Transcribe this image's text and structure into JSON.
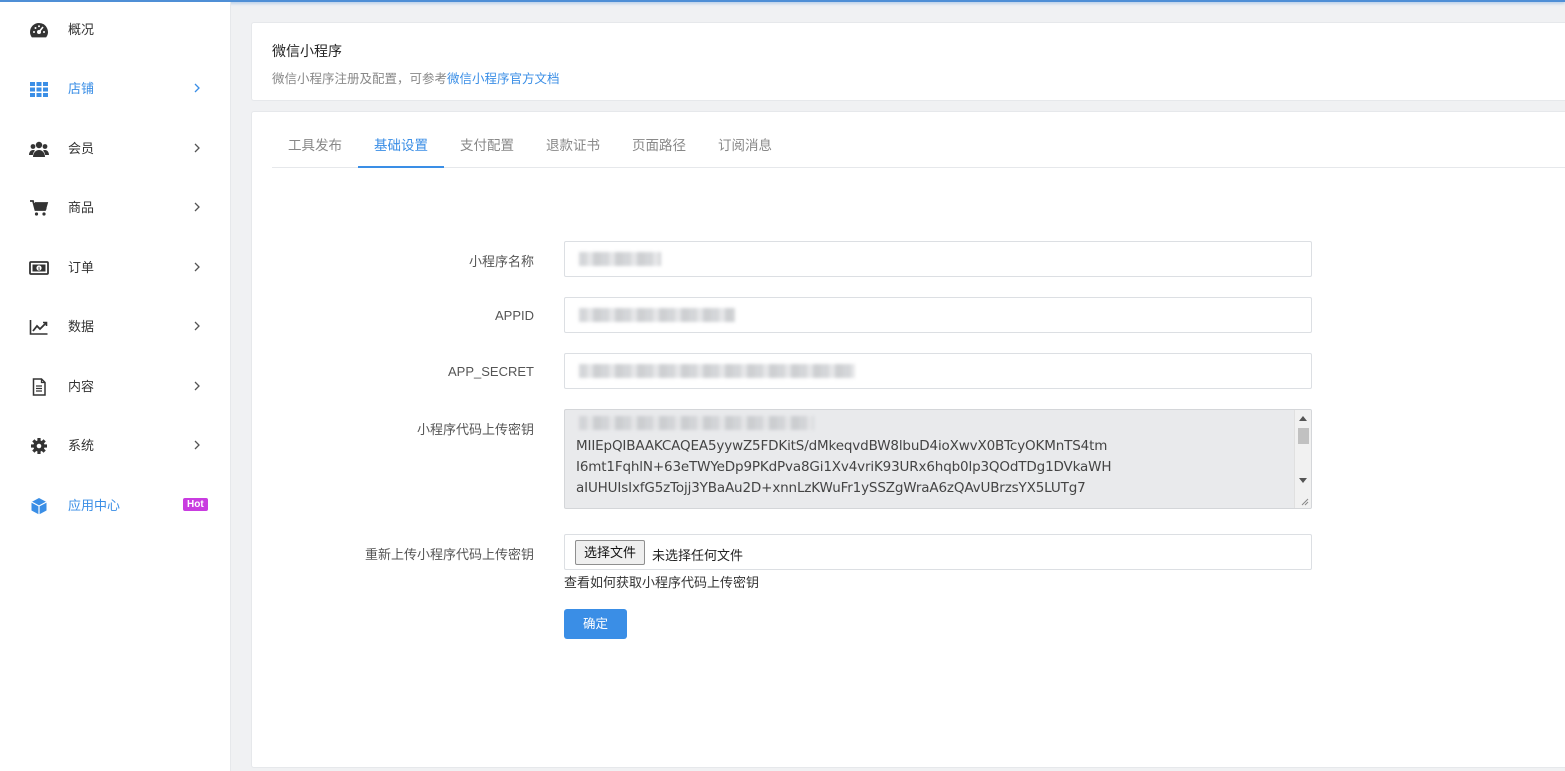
{
  "sidebar": {
    "items": [
      {
        "label": "概况",
        "icon": "dashboard-icon",
        "has_chevron": false
      },
      {
        "label": "店铺",
        "icon": "grid-icon",
        "has_chevron": true,
        "active": true
      },
      {
        "label": "会员",
        "icon": "users-icon",
        "has_chevron": true
      },
      {
        "label": "商品",
        "icon": "cart-icon",
        "has_chevron": true
      },
      {
        "label": "订单",
        "icon": "money-icon",
        "has_chevron": true
      },
      {
        "label": "数据",
        "icon": "line-chart-icon",
        "has_chevron": true
      },
      {
        "label": "内容",
        "icon": "document-icon",
        "has_chevron": true
      },
      {
        "label": "系统",
        "icon": "gear-icon",
        "has_chevron": true
      },
      {
        "label": "应用中心",
        "icon": "cube-icon",
        "has_chevron": false,
        "badge": "Hot"
      }
    ]
  },
  "header": {
    "title": "微信小程序",
    "subtitle_prefix": "微信小程序注册及配置，可参考",
    "subtitle_link": "微信小程序官方文档"
  },
  "tabs": [
    {
      "label": "工具发布"
    },
    {
      "label": "基础设置",
      "active": true
    },
    {
      "label": "支付配置"
    },
    {
      "label": "退款证书"
    },
    {
      "label": "页面路径"
    },
    {
      "label": "订阅消息"
    }
  ],
  "form": {
    "name_label": "小程序名称",
    "appid_label": "APPID",
    "secret_label": "APP_SECRET",
    "upload_key_label": "小程序代码上传密钥",
    "upload_key_lines": [
      "MIIEpQIBAAKCAQEA5yywZ5FDKitS/dMkeqvdBW8lbuD4ioXwvX0BTcyOKMnTS4tm",
      "I6mt1FqhlN+63eTWYeDp9PKdPva8Gi1Xv4vriK93URx6hqb0lp3QOdTDg1DVkaWH",
      "aIUHUIsIxfG5zTojj3YBaAu2D+xnnLzKWuFr1ySSZgWraA6zQAvUBrzsYX5LUTg7"
    ],
    "reupload_label": "重新上传小程序代码上传密钥",
    "file_button": "选择文件",
    "file_status": "未选择任何文件",
    "help_text": "查看如何获取小程序代码上传密钥",
    "submit_label": "确定"
  },
  "colors": {
    "accent": "#3a8ee6",
    "hot_badge": "#c93ce0",
    "textarea_bg": "#e9eaec"
  }
}
